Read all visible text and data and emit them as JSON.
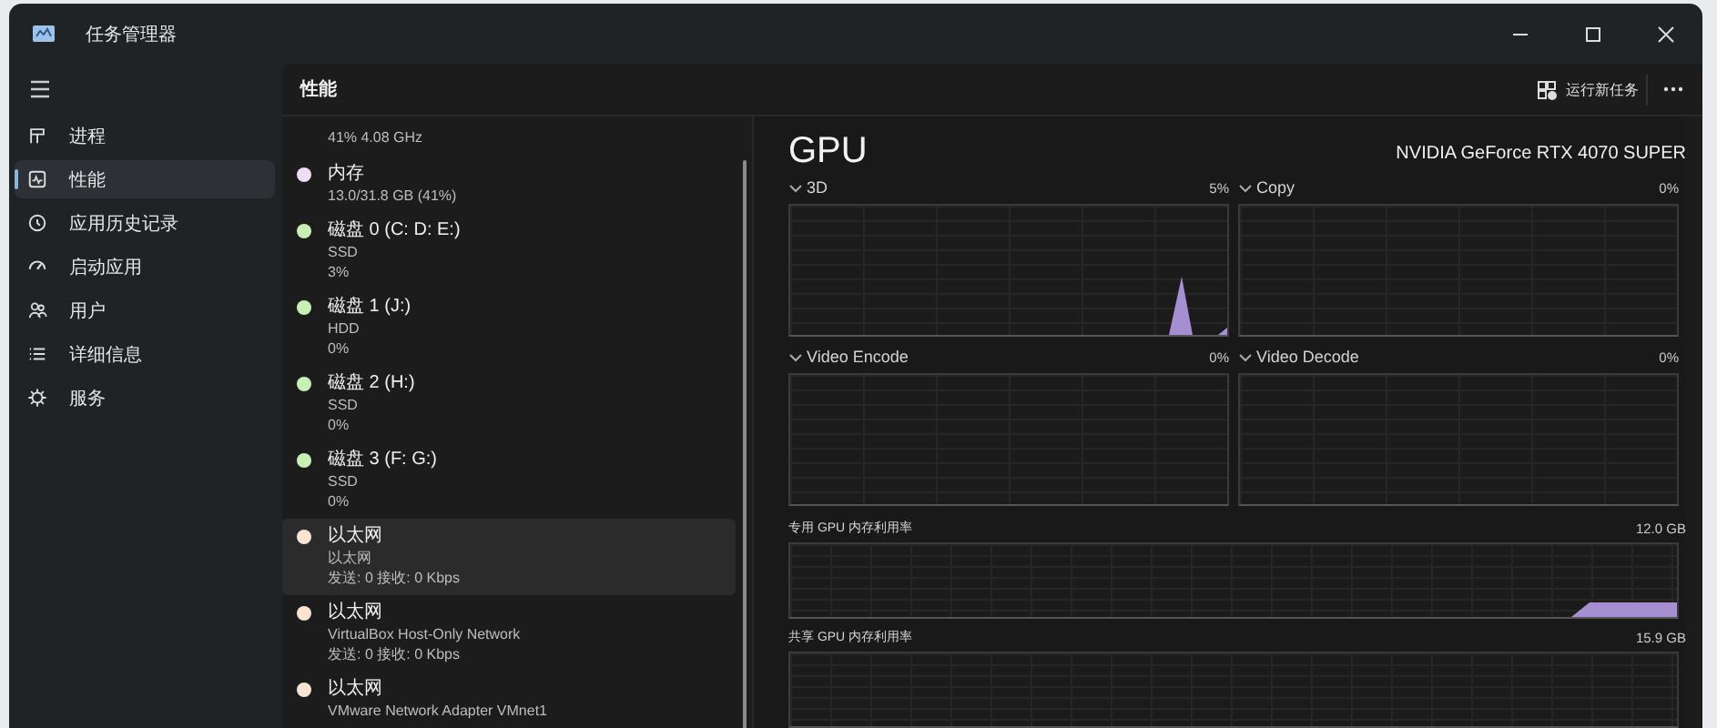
{
  "window": {
    "title": "任务管理器"
  },
  "sidebar": {
    "items": [
      {
        "label": "进程",
        "selected": false
      },
      {
        "label": "性能",
        "selected": true
      },
      {
        "label": "应用历史记录",
        "selected": false
      },
      {
        "label": "启动应用",
        "selected": false
      },
      {
        "label": "用户",
        "selected": false
      },
      {
        "label": "详细信息",
        "selected": false
      },
      {
        "label": "服务",
        "selected": false
      }
    ]
  },
  "header": {
    "title": "性能",
    "action": "运行新任务"
  },
  "devices": [
    {
      "lines": [
        "41% 4.08 GHz"
      ],
      "selected": false
    },
    {
      "name": "内存",
      "color": "#f0dcf5",
      "lines": [
        "13.0/31.8 GB (41%)"
      ],
      "selected": false
    },
    {
      "name": "磁盘 0 (C: D: E:)",
      "color": "#c8f0b4",
      "lines": [
        "SSD",
        "3%"
      ],
      "selected": false
    },
    {
      "name": "磁盘 1 (J:)",
      "color": "#c8f0b4",
      "lines": [
        "HDD",
        "0%"
      ],
      "selected": false
    },
    {
      "name": "磁盘 2 (H:)",
      "color": "#c8f0b4",
      "lines": [
        "SSD",
        "0%"
      ],
      "selected": false
    },
    {
      "name": "磁盘 3 (F: G:)",
      "color": "#c8f0b4",
      "lines": [
        "SSD",
        "0%"
      ],
      "selected": false
    },
    {
      "name": "以太网",
      "color": "#f8e4d2",
      "lines": [
        "以太网",
        "发送: 0 接收: 0 Kbps"
      ],
      "selected": true
    },
    {
      "name": "以太网",
      "color": "#f8e4d2",
      "lines": [
        "VirtualBox Host-Only Network",
        "发送: 0 接收: 0 Kbps"
      ],
      "selected": false
    },
    {
      "name": "以太网",
      "color": "#f8e4d2",
      "lines": [
        "VMware Network Adapter VMnet1"
      ],
      "selected": false
    }
  ],
  "gpu": {
    "title": "GPU",
    "model": "NVIDIA GeForce RTX 4070 SUPER",
    "engines": [
      {
        "label": "3D",
        "value": "5%"
      },
      {
        "label": "Copy",
        "value": "0%"
      },
      {
        "label": "Video Encode",
        "value": "0%"
      },
      {
        "label": "Video Decode",
        "value": "0%"
      }
    ],
    "memory": [
      {
        "label": "专用 GPU 内存利用率",
        "value": "12.0 GB"
      },
      {
        "label": "共享 GPU 内存利用率",
        "value": "15.9 GB"
      }
    ]
  }
}
